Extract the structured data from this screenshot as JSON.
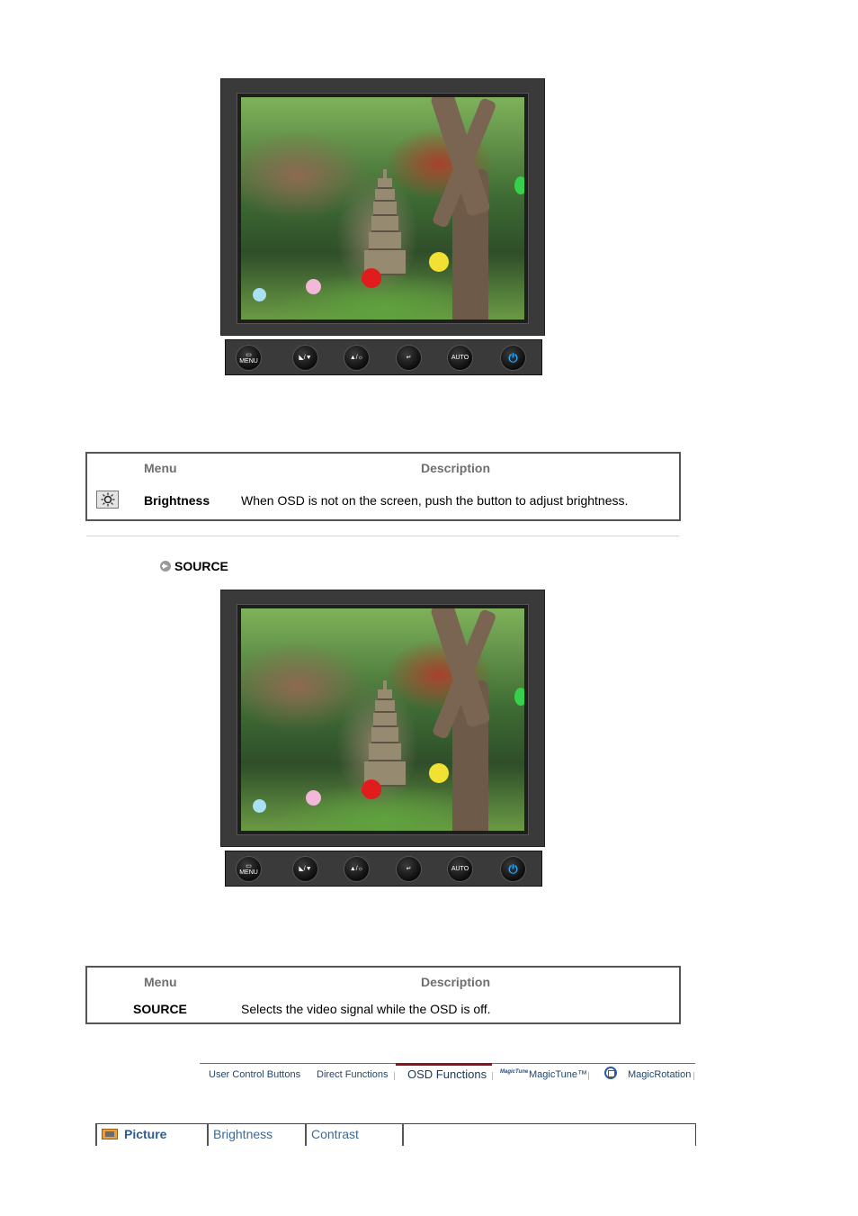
{
  "monitor_buttons": [
    {
      "icon": "menu-icon",
      "label": "MENU",
      "glyph": "▭"
    },
    {
      "icon": "magicbright-down-icon",
      "label": "",
      "glyph": "◣/▼"
    },
    {
      "icon": "up-brightness-icon",
      "label": "",
      "glyph": "▲/☼"
    },
    {
      "icon": "enter-source-icon",
      "label": "",
      "glyph": "↵"
    },
    {
      "icon": "auto-icon",
      "label": "AUTO",
      "glyph": ""
    },
    {
      "icon": "power-icon",
      "label": "",
      "glyph": "⏻"
    }
  ],
  "brightness_table": {
    "header_menu": "Menu",
    "header_description": "Description",
    "row": {
      "icon": "brightness-sun-icon",
      "menu": "Brightness",
      "description": "When OSD is not on the screen, push the button to adjust brightness."
    }
  },
  "source_section": {
    "heading": "SOURCE",
    "heading_icon": "arrow-circle-icon"
  },
  "source_table": {
    "header_menu": "Menu",
    "header_description": "Description",
    "row": {
      "menu": "SOURCE",
      "description": "Selects the video signal while the OSD is off."
    }
  },
  "nav": {
    "items": [
      {
        "label": "User Control Buttons",
        "active": false
      },
      {
        "label": "Direct Functions",
        "active": false
      },
      {
        "label": "OSD Functions",
        "active": true
      },
      {
        "label": "MagicTune™",
        "active": false,
        "logo": "MagicTune"
      },
      {
        "label": "MagicRotation",
        "active": false
      }
    ],
    "active_color": "#8b1220"
  },
  "sub_tabs": [
    {
      "label": "Picture",
      "active": true,
      "icon": "picture-icon"
    },
    {
      "label": "Brightness",
      "active": false
    },
    {
      "label": "Contrast",
      "active": false
    }
  ]
}
